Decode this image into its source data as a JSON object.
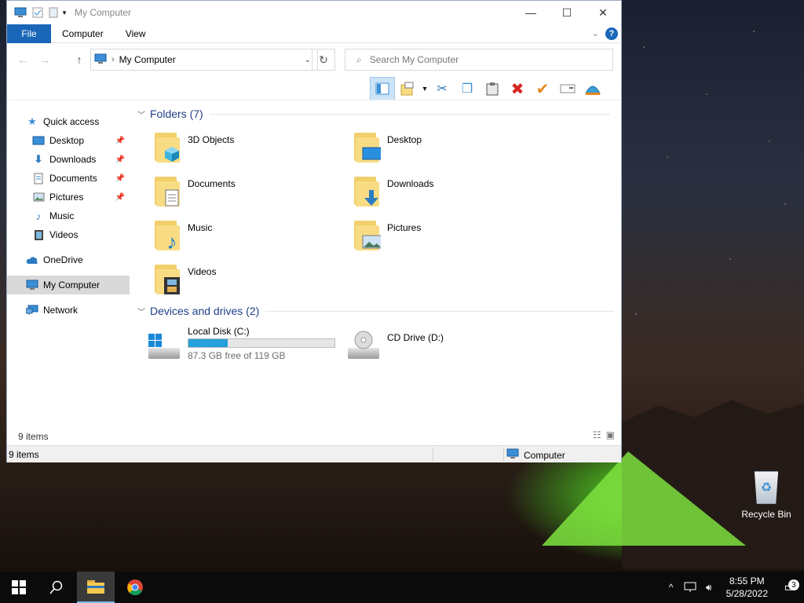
{
  "window": {
    "title": "My Computer",
    "minimize": "—",
    "maximize": "☐",
    "close": "✕"
  },
  "ribbon": {
    "tabs": [
      "File",
      "Computer",
      "View"
    ],
    "help": "?",
    "collapse": "⌄"
  },
  "address": {
    "location": "My Computer",
    "separator": "›",
    "dropdown": "⌄",
    "refresh": "↻"
  },
  "search": {
    "placeholder": "Search My Computer",
    "icon": "⌕"
  },
  "nav": {
    "back": "←",
    "forward": "→",
    "up": "↑"
  },
  "toolbar": {
    "buttons": [
      "preview-pane-icon",
      "properties-icon",
      "cut-icon",
      "copy-icon",
      "paste-icon",
      "delete-icon",
      "check-icon",
      "rename-icon",
      "shell-icon"
    ],
    "glyphs": [
      "▭",
      "▤",
      "✂",
      "❐",
      "📋",
      "✖",
      "✔",
      "▭",
      "🐚"
    ],
    "dropdown": "▾"
  },
  "sidebar": {
    "quick_access": "Quick access",
    "items": [
      {
        "label": "Desktop",
        "pin": "📌"
      },
      {
        "label": "Downloads",
        "pin": "📌"
      },
      {
        "label": "Documents",
        "pin": "📌"
      },
      {
        "label": "Pictures",
        "pin": "📌"
      },
      {
        "label": "Music"
      },
      {
        "label": "Videos"
      }
    ],
    "onedrive": "OneDrive",
    "my_computer": "My Computer",
    "network": "Network"
  },
  "content": {
    "folders_header": "Folders (7)",
    "folders": [
      "3D Objects",
      "Desktop",
      "Documents",
      "Downloads",
      "Music",
      "Pictures",
      "Videos"
    ],
    "devices_header": "Devices and drives (2)",
    "drives": [
      {
        "name": "Local Disk (C:)",
        "free": "87.3 GB free of 119 GB",
        "used_fraction": 0.27
      },
      {
        "name": "CD Drive (D:)"
      }
    ]
  },
  "status": {
    "item_count": "9 items",
    "bar_count": "9 items",
    "location": "Computer"
  },
  "desktop": {
    "recycle_bin": "Recycle Bin"
  },
  "taskbar": {
    "time": "8:55 PM",
    "date": "5/28/2022",
    "notifications": "3"
  },
  "colors": {
    "accent": "#1a66b8",
    "progress": "#26a0da",
    "group_header": "#1e3f87"
  }
}
